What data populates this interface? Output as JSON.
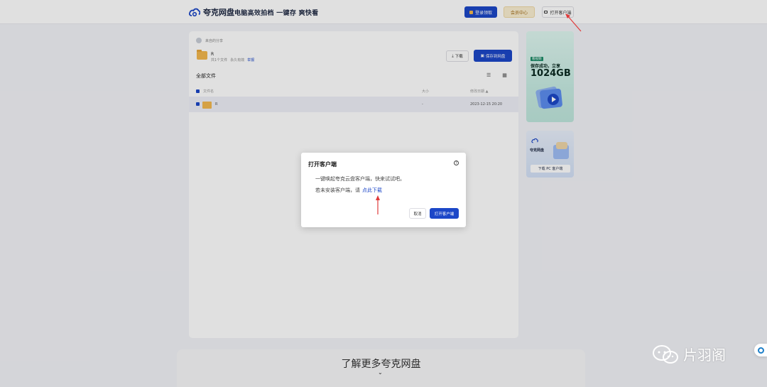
{
  "header": {
    "brand": "夸克网盘",
    "slogan": "电脑高效拍档  一键存 爽快看",
    "login_label": "登录领取",
    "member_label": "会员中心",
    "open_client_label": "打开客户端"
  },
  "share": {
    "from": "来自的分享",
    "title": "R",
    "file_count": "共1个文件",
    "meta_extra": "永久有效",
    "report": "举报",
    "download_label": "下载",
    "save_label": "保存到网盘"
  },
  "files": {
    "section_title": "全部文件",
    "columns": {
      "name": "文件名",
      "size": "大小",
      "modified": "修改日期 ▲"
    },
    "rows": [
      {
        "name": "R",
        "size": "-",
        "modified": "2023-12-15 20:20"
      }
    ]
  },
  "banner_promo": {
    "tag": "看视频",
    "line1": "保存成功，立享",
    "big": "1024GB"
  },
  "banner_client": {
    "name": "夸克网盘",
    "button": "下载 PC 客户端"
  },
  "footer": {
    "text": "了解更多夸克网盘",
    "chevron": "⌄"
  },
  "modal": {
    "title": "打开客户端",
    "help": "?",
    "line1": "一键唤起夸克云盘客户端，快来试试吧。",
    "line2_prefix": "若未安装客户端，请",
    "line2_link": "点此下载",
    "cancel_label": "取消",
    "confirm_label": "打开客户端"
  },
  "watermark": {
    "text": "片羽阁"
  },
  "colors": {
    "primary": "#1c47c8",
    "annotation_red": "#e03a3a",
    "folder": "#f3b84e"
  }
}
